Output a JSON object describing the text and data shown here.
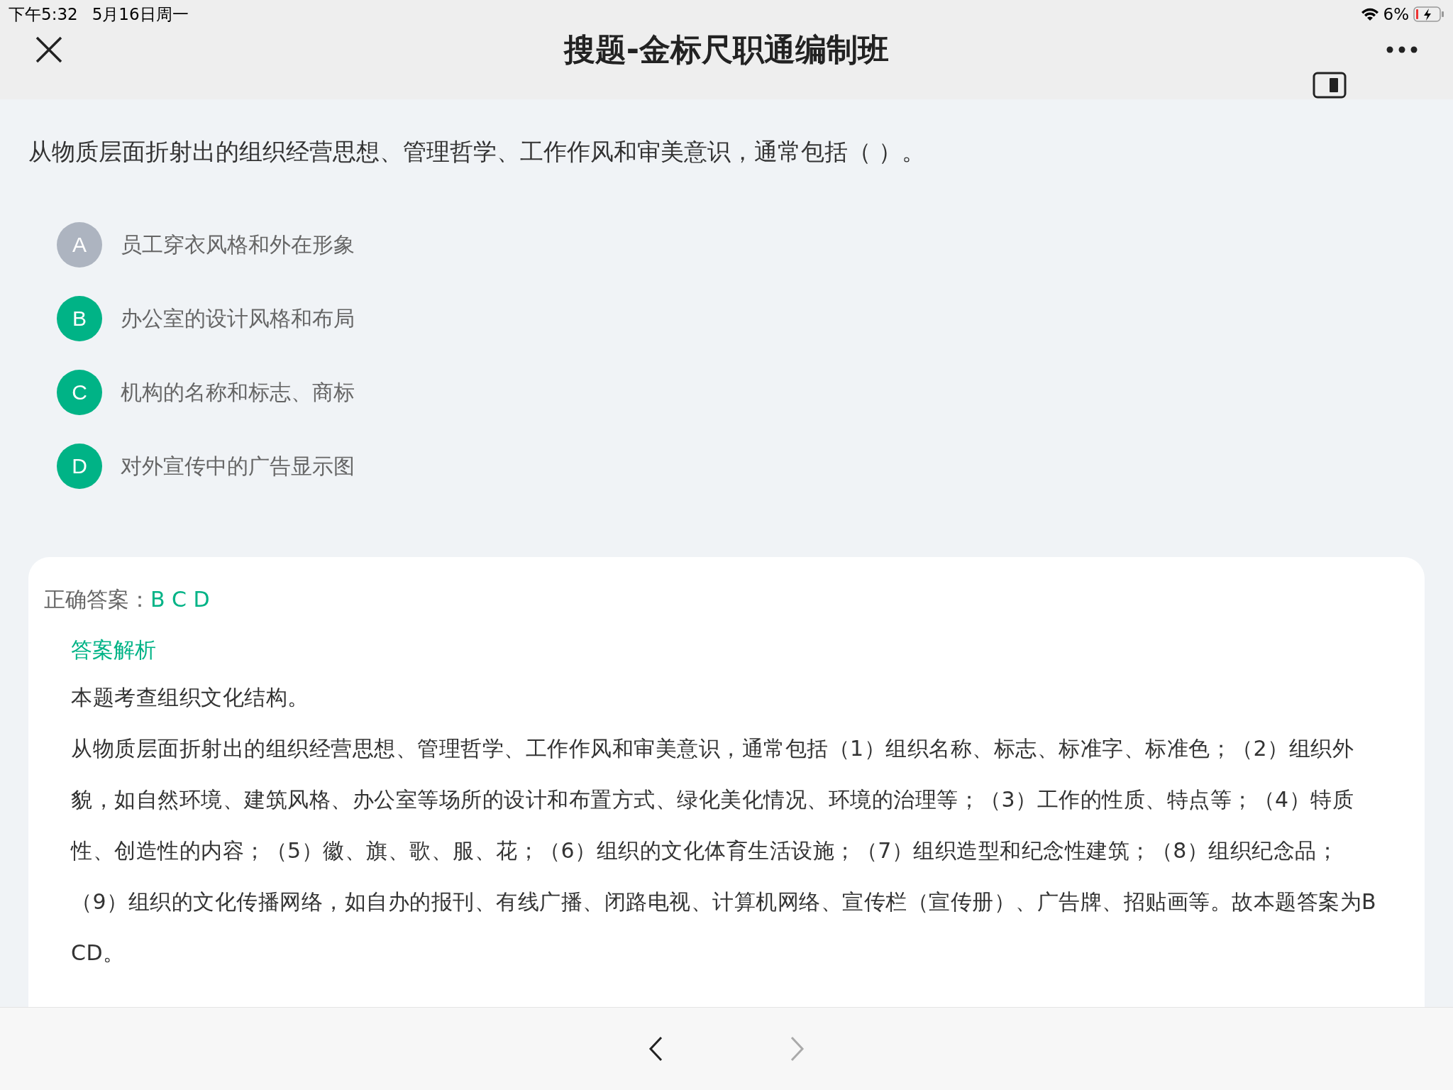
{
  "status_bar": {
    "time": "下午5:32",
    "date": "5月16日周一",
    "battery": "6%"
  },
  "nav": {
    "title": "搜题-金标尺职通编制班"
  },
  "question": {
    "text": "从物质层面折射出的组织经营思想、管理哲学、工作作风和审美意识，通常包括（ ）。",
    "options": [
      {
        "letter": "A",
        "text": "员工穿衣风格和外在形象",
        "selected": false
      },
      {
        "letter": "B",
        "text": "办公室的设计风格和布局",
        "selected": true
      },
      {
        "letter": "C",
        "text": "机构的名称和标志、商标",
        "selected": true
      },
      {
        "letter": "D",
        "text": "对外宣传中的广告显示图",
        "selected": true
      }
    ]
  },
  "answer": {
    "label": "正确答案：",
    "value": "B C D",
    "analysis_title": "答案解析",
    "paragraphs": [
      "本题考查组织文化结构。",
      "从物质层面折射出的组织经营思想、管理哲学、工作作风和审美意识，通常包括（1）组织名称、标志、标准字、标准色；（2）组织外貌，如自然环境、建筑风格、办公室等场所的设计和布置方式、绿化美化情况、环境的治理等；（3）工作的性质、特点等；（4）特质性、创造性的内容；（5）徽、旗、歌、服、花；（6）组织的文化体育生活设施；（7）组织造型和纪念性建筑；（8）组织纪念品；（9）组织的文化传播网络，如自办的报刊、有线广播、闭路电视、计算机网络、宣传栏（宣传册）、广告牌、招贴画等。故本题答案为BCD。"
    ]
  }
}
